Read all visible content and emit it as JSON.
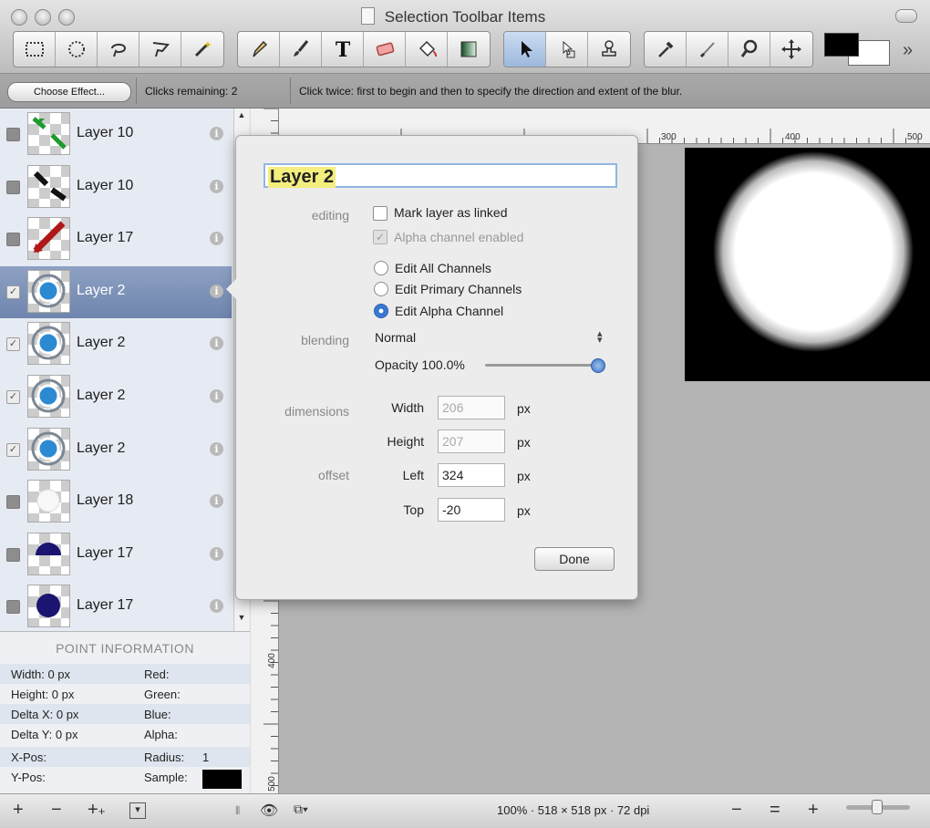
{
  "window": {
    "title": "Selection Toolbar Items"
  },
  "toolbar": {
    "tools": [
      "rect-select-icon",
      "ellipse-select-icon",
      "lasso-icon",
      "polygon-lasso-icon",
      "magic-wand-icon",
      "pencil-icon",
      "brush-icon",
      "text-icon",
      "eraser-icon",
      "paint-bucket-icon",
      "gradient-icon",
      "pointer-icon",
      "clone-icon",
      "stamp-icon",
      "eyedropper-icon",
      "smudge-icon",
      "zoom-icon",
      "move-icon"
    ],
    "active_tool": "pointer-icon",
    "foreground_color": "#000000",
    "background_color": "#ffffff",
    "overflow": "»"
  },
  "effect_bar": {
    "choose_effect": "Choose Effect...",
    "clicks_remaining": "Clicks remaining: 2",
    "hint": "Click twice: first to begin and then to specify the direction and extent of the blur."
  },
  "layers": [
    {
      "name": "Layer 10",
      "visible": false,
      "thumb": "green-arrows",
      "info": "i"
    },
    {
      "name": "Layer 10",
      "visible": false,
      "thumb": "black-arrows",
      "info": "i"
    },
    {
      "name": "Layer 17",
      "visible": false,
      "thumb": "red-arrows",
      "info": "i"
    },
    {
      "name": "Layer 2",
      "visible": true,
      "selected": true,
      "thumb": "blue-ring",
      "info": "i"
    },
    {
      "name": "Layer 2",
      "visible": true,
      "thumb": "blue-ring",
      "info": "i"
    },
    {
      "name": "Layer 2",
      "visible": true,
      "thumb": "blue-ring",
      "info": "i"
    },
    {
      "name": "Layer 2",
      "visible": true,
      "thumb": "blue-ring",
      "info": "i"
    },
    {
      "name": "Layer 18",
      "visible": false,
      "thumb": "faint",
      "info": "i"
    },
    {
      "name": "Layer 17",
      "visible": false,
      "thumb": "navy-half",
      "info": "i"
    },
    {
      "name": "Layer 17",
      "visible": false,
      "thumb": "navy-circle",
      "info": "i"
    }
  ],
  "point_info": {
    "title": "POINT INFORMATION",
    "width": "Width:  0 px",
    "height": "Height:  0 px",
    "delta_x": "Delta X: 0 px",
    "delta_y": "Delta Y: 0 px",
    "red": "Red:",
    "green": "Green:",
    "blue": "Blue:",
    "alpha": "Alpha:",
    "x_pos": "X-Pos:",
    "y_pos": "Y-Pos:",
    "radius": "Radius:",
    "radius_value": "1",
    "sample": "Sample:"
  },
  "bottom": {
    "add": "+",
    "remove": "−",
    "add_group": "+",
    "menu": "▾",
    "zoom_readout": "100% · 518 × 518 px · 72 dpi",
    "zoom_out": "−",
    "zoom_fit": "=",
    "zoom_in": "+"
  },
  "rulers": {
    "h_300": "300",
    "h_400": "400",
    "h_500": "500",
    "v_400": "400",
    "v_500": "500"
  },
  "popover": {
    "layer_name": "Layer 2",
    "editing_label": "editing",
    "mark_linked": "Mark layer as linked",
    "alpha_enabled": "Alpha channel enabled",
    "edit_all": "Edit All Channels",
    "edit_primary": "Edit Primary Channels",
    "edit_alpha": "Edit Alpha Channel",
    "selected_channel": "edit_alpha",
    "blending_label": "blending",
    "blend_mode": "Normal",
    "opacity_label": "Opacity 100.0%",
    "opacity": 1.0,
    "dimensions_label": "dimensions",
    "width_label": "Width",
    "width_value": "206",
    "height_label": "Height",
    "height_value": "207",
    "offset_label": "offset",
    "left_label": "Left",
    "left_value": "324",
    "top_label": "Top",
    "top_value": "-20",
    "unit": "px",
    "done": "Done"
  }
}
